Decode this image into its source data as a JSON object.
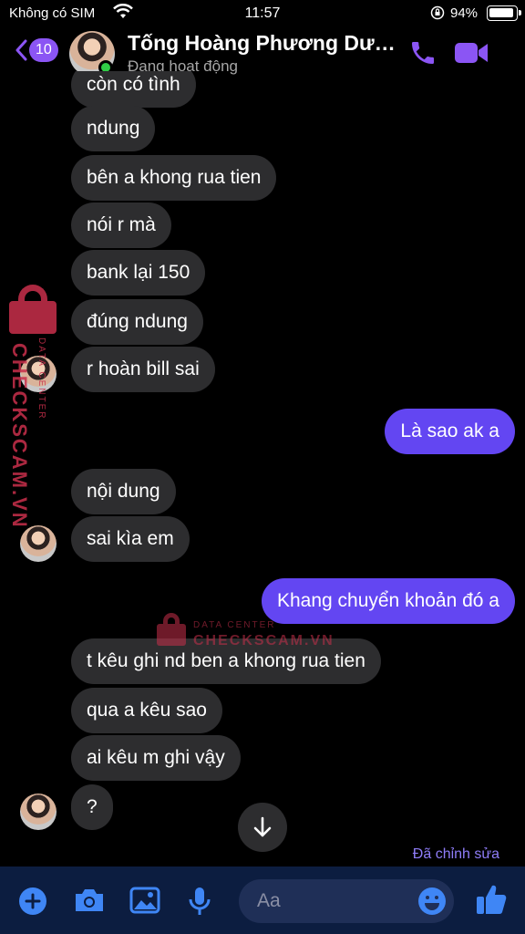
{
  "status_bar": {
    "carrier": "Không có SIM",
    "time": "11:57",
    "battery_percent": "94%",
    "battery_level": 0.94
  },
  "header": {
    "unread_count": "10",
    "contact_name": "Tống Hoàng Phương Dươ...",
    "status": "Đang hoạt động",
    "accent_color": "#8b55f4"
  },
  "messages": [
    {
      "direction": "in",
      "text": "còn có tình",
      "show_avatar": false
    },
    {
      "direction": "in",
      "text": "ndung",
      "show_avatar": false
    },
    {
      "direction": "in",
      "text": "bên a khong rua tien",
      "show_avatar": false
    },
    {
      "direction": "in",
      "text": "nói r mà",
      "show_avatar": false
    },
    {
      "direction": "in",
      "text": "bank lại 150",
      "show_avatar": false
    },
    {
      "direction": "in",
      "text": "đúng ndung",
      "show_avatar": false
    },
    {
      "direction": "in",
      "text": "r hoàn bill sai",
      "show_avatar": true
    },
    {
      "direction": "out",
      "text": "Là sao ak a",
      "show_avatar": false
    },
    {
      "direction": "in",
      "text": "nội dung",
      "show_avatar": false
    },
    {
      "direction": "in",
      "text": "sai kìa em",
      "show_avatar": true
    },
    {
      "direction": "out",
      "text": "Khang chuyển khoản đó a",
      "show_avatar": false
    },
    {
      "direction": "in",
      "text": "t kêu ghi nd ben a khong rua tien",
      "show_avatar": false
    },
    {
      "direction": "in",
      "text": "qua a kêu sao",
      "show_avatar": false
    },
    {
      "direction": "in",
      "text": "ai kêu m ghi vậy",
      "show_avatar": false
    },
    {
      "direction": "in",
      "text": "?",
      "show_avatar": true
    }
  ],
  "edited_label": "Đã chỉnh sửa",
  "composer": {
    "placeholder": "Aa",
    "icons": [
      "plus-icon",
      "camera-icon",
      "image-icon",
      "microphone-icon",
      "emoji-icon",
      "thumbs-up-icon"
    ]
  },
  "watermark": {
    "brand": "CHECKSCAM.VN",
    "tagline": "DATA CENTER",
    "color": "#c9304c"
  },
  "colors": {
    "incoming_bubble": "#2d2d2f",
    "outgoing_bubble": "#6346f2",
    "composer_bg": "#0c1d40"
  }
}
